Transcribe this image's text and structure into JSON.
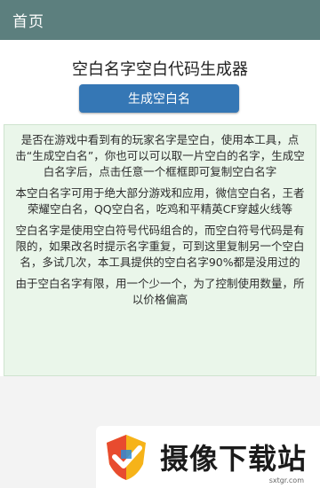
{
  "header": {
    "title": "首页"
  },
  "tool": {
    "title": "空白名字空白代码生成器",
    "button_label": "生成空白名"
  },
  "info": {
    "paragraphs": [
      "是否在游戏中看到有的玩家名字是空白，使用本工具，点击“生成空白名”，你也可以可以取一片空白的名字，生成空白名字后，点击任意一个框框即可复制空白名字",
      "本空白名字可用于绝大部分游戏和应用，微信空白名，王者荣耀空白名，QQ空白名，吃鸡和平精英CF穿越火线等",
      "空白名字是使用空白符号代码组合的，而空白符号代码是有限的，如果改名时提示名字重复，可到这里复制另一个空白名，多试几次，本工具提供的空白名字90%都是没用过的",
      "由于空白名字有限，用一个少一个，为了控制使用数量，所以价格偏高"
    ]
  },
  "watermark": {
    "brand": "摄像下载站",
    "domain": "sxtgr.com",
    "icon": "shield-logo-icon"
  },
  "colors": {
    "header_bg": "#5c7f7e",
    "button_bg": "#3577b5",
    "info_bg": "#eaf6ea"
  }
}
